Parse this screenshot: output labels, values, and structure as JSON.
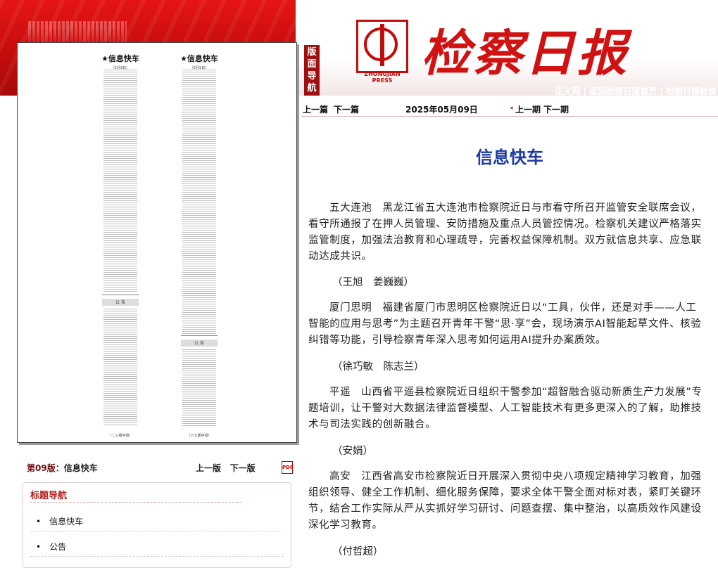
{
  "header": {
    "masthead": "检察日报",
    "logo_caption": "ZHONGJIAN PRESS",
    "banmian_label": [
      "版",
      "面",
      "导",
      "航"
    ],
    "links": [
      "正义网",
      "返回检察日报首页",
      "检察日报检索"
    ]
  },
  "nav": {
    "prev_article": "上一篇",
    "next_article": "下一篇",
    "date": "2025年05月09日",
    "prev_issue": "上一期",
    "next_issue": "下一期"
  },
  "paper_thumb": {
    "left": {
      "title": "★信息快车",
      "date": "（5月9日）",
      "notice": "公  告",
      "footer": "（二三版中缝）"
    },
    "right": {
      "title": "★信息快车",
      "date": "（5月9日）",
      "notice": "公  告",
      "footer": "（六七版中缝）"
    }
  },
  "edition": {
    "page_label": "第09版：",
    "page_name": "信息快车",
    "prev_page": "上一版",
    "next_page": "下一版",
    "pdf_icon": "pdf-icon"
  },
  "section_nav": {
    "title": "标题导航",
    "items": [
      "信息快车",
      "公告"
    ]
  },
  "article": {
    "title": "信息快车",
    "paragraphs": [
      "五大连池　黑龙江省五大连池市检察院近日与市看守所召开监管安全联席会议，看守所通报了在押人员管理、安防措施及重点人员管控情况。检察机关建议严格落实监管制度，加强法治教育和心理疏导，完善权益保障机制。双方就信息共享、应急联动达成共识。",
      "厦门思明　福建省厦门市思明区检察院近日以“工具，伙伴，还是对手——人工智能的应用与思考”为主题召开青年干警“思·享”会，现场演示AI智能起草文件、核验纠错等功能，引导检察青年深入思考如何运用AI提升办案质效。",
      "平遥　山西省平遥县检察院近日组织干警参加“超智融合驱动新质生产力发展”专题培训，让干警对大数据法律监督模型、人工智能技术有更多更深入的了解，助推技术与司法实践的创新融合。",
      "高安　江西省高安市检察院近日开展深入贯彻中央八项规定精神学习教育，加强组织领导、健全工作机制、细化服务保障，要求全体干警全面对标对表，紧盯关键环节，结合工作实际从严从实抓好学习研讨、问题查摆、集中整治，以高质效作风建设深化学习教育。"
    ],
    "authors": [
      "（王旭　姜巍巍）",
      "（徐巧敏　陈志兰）",
      "（安娟）",
      "（付哲超）"
    ]
  },
  "colors": {
    "brand_red": "#d11212",
    "title_blue": "#1d3aa7"
  }
}
